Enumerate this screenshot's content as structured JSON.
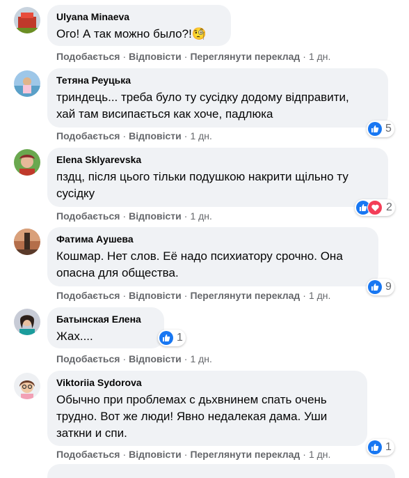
{
  "actions": {
    "like": "Подобається",
    "reply": "Відповісти",
    "translate": "Переглянути переклад",
    "sep": "·"
  },
  "comments": [
    {
      "author": "Ulyana Minaeva",
      "text": "Ого! А так можно было?!🧐",
      "time": "1 дн.",
      "translate": true,
      "reactions": "",
      "reaction_types": []
    },
    {
      "author": "Тетяна Реуцька",
      "text": "триндець... треба було ту сусідку додому відправити,\nхай там висипається как хоче, падлюка",
      "time": "1 дн.",
      "translate": false,
      "reactions": "5",
      "reaction_types": [
        "like"
      ]
    },
    {
      "author": "Elena Sklyarevska",
      "text": "пздц, після цього тільки подушкою накрити щільно ту\nсусідку",
      "time": "1 дн.",
      "translate": false,
      "reactions": "2",
      "reaction_types": [
        "like",
        "love"
      ]
    },
    {
      "author": "Фатима Аушева",
      "text": "Кошмар. Нет слов. Её надо психиатору срочно. Она\nопасна для общества.",
      "time": "1 дн.",
      "translate": true,
      "reactions": "9",
      "reaction_types": [
        "like"
      ]
    },
    {
      "author": "Батынская Елена",
      "text": "Жах....",
      "time": "1 дн.",
      "translate": false,
      "reactions": "1",
      "reaction_types": [
        "like"
      ]
    },
    {
      "author": "Viktoriia Sydorova",
      "text": "Обычно при проблемах с дьхвнинем спать очень\nтрудно. Вот же люди! Явно недалекая дама. Уши\nзаткни и спи.",
      "time": "1 дн.",
      "translate": true,
      "reactions": "1",
      "reaction_types": [
        "like"
      ]
    }
  ],
  "colors": {
    "like": "#1877f2",
    "love": "#f33e58",
    "bubble": "#f0f2f5",
    "meta": "#65676b"
  }
}
